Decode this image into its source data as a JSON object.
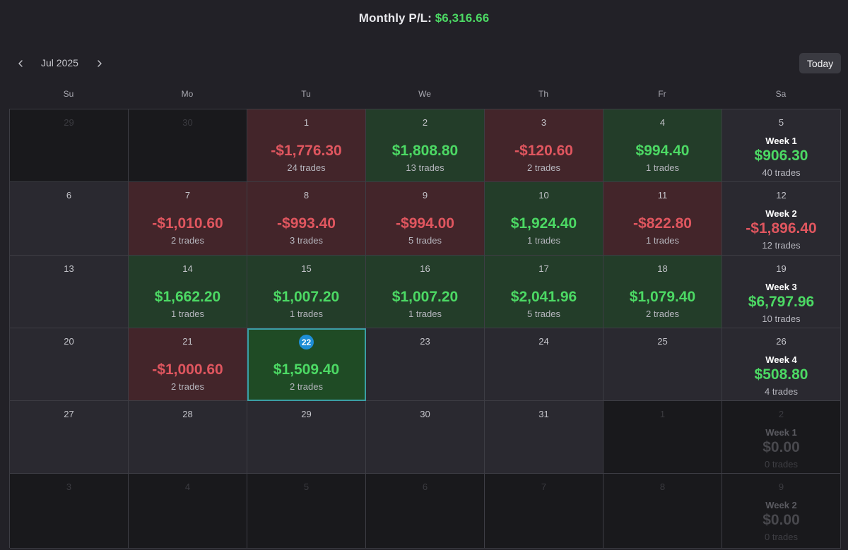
{
  "header": {
    "label": "Monthly P/L:",
    "value": "$6,316.66"
  },
  "nav": {
    "prev_icon": "chevron-left-icon",
    "next_icon": "chevron-right-icon",
    "month": "Jul 2025",
    "today_label": "Today"
  },
  "days_of_week": [
    "Su",
    "Mo",
    "Tu",
    "We",
    "Th",
    "Fr",
    "Sa"
  ],
  "colors": {
    "profit": "#4cd964",
    "loss": "#e0565f",
    "profit_bg": "#233d29",
    "loss_bg": "#43252a",
    "today_ring": "#3a9ea4",
    "today_badge": "#1e8ed6"
  },
  "weeks": [
    {
      "days": [
        {
          "day": "29",
          "muted": true
        },
        {
          "day": "30",
          "muted": true
        },
        {
          "day": "1",
          "pnl": "-$1,776.30",
          "trades": "24 trades",
          "status": "loss"
        },
        {
          "day": "2",
          "pnl": "$1,808.80",
          "trades": "13 trades",
          "status": "profit"
        },
        {
          "day": "3",
          "pnl": "-$120.60",
          "trades": "2 trades",
          "status": "loss"
        },
        {
          "day": "4",
          "pnl": "$994.40",
          "trades": "1 trades",
          "status": "profit"
        }
      ],
      "saturday": {
        "day": "5",
        "week": "Week 1",
        "pnl": "$906.30",
        "trades": "40 trades",
        "status": "profit"
      }
    },
    {
      "days": [
        {
          "day": "6"
        },
        {
          "day": "7",
          "pnl": "-$1,010.60",
          "trades": "2 trades",
          "status": "loss"
        },
        {
          "day": "8",
          "pnl": "-$993.40",
          "trades": "3 trades",
          "status": "loss"
        },
        {
          "day": "9",
          "pnl": "-$994.00",
          "trades": "5 trades",
          "status": "loss"
        },
        {
          "day": "10",
          "pnl": "$1,924.40",
          "trades": "1 trades",
          "status": "profit"
        },
        {
          "day": "11",
          "pnl": "-$822.80",
          "trades": "1 trades",
          "status": "loss"
        }
      ],
      "saturday": {
        "day": "12",
        "week": "Week 2",
        "pnl": "-$1,896.40",
        "trades": "12 trades",
        "status": "loss"
      }
    },
    {
      "days": [
        {
          "day": "13"
        },
        {
          "day": "14",
          "pnl": "$1,662.20",
          "trades": "1 trades",
          "status": "profit"
        },
        {
          "day": "15",
          "pnl": "$1,007.20",
          "trades": "1 trades",
          "status": "profit"
        },
        {
          "day": "16",
          "pnl": "$1,007.20",
          "trades": "1 trades",
          "status": "profit"
        },
        {
          "day": "17",
          "pnl": "$2,041.96",
          "trades": "5 trades",
          "status": "profit"
        },
        {
          "day": "18",
          "pnl": "$1,079.40",
          "trades": "2 trades",
          "status": "profit"
        }
      ],
      "saturday": {
        "day": "19",
        "week": "Week 3",
        "pnl": "$6,797.96",
        "trades": "10 trades",
        "status": "profit"
      }
    },
    {
      "days": [
        {
          "day": "20"
        },
        {
          "day": "21",
          "pnl": "-$1,000.60",
          "trades": "2 trades",
          "status": "loss"
        },
        {
          "day": "22",
          "pnl": "$1,509.40",
          "trades": "2 trades",
          "status": "profit",
          "today": true
        },
        {
          "day": "23"
        },
        {
          "day": "24"
        },
        {
          "day": "25"
        }
      ],
      "saturday": {
        "day": "26",
        "week": "Week 4",
        "pnl": "$508.80",
        "trades": "4 trades",
        "status": "profit"
      }
    },
    {
      "days": [
        {
          "day": "27"
        },
        {
          "day": "28"
        },
        {
          "day": "29"
        },
        {
          "day": "30"
        },
        {
          "day": "31"
        },
        {
          "day": "1",
          "muted": true
        }
      ],
      "saturday": {
        "day": "2",
        "week": "Week 1",
        "pnl": "$0.00",
        "trades": "0 trades",
        "muted": true
      }
    },
    {
      "days": [
        {
          "day": "3",
          "muted": true
        },
        {
          "day": "4",
          "muted": true
        },
        {
          "day": "5",
          "muted": true
        },
        {
          "day": "6",
          "muted": true
        },
        {
          "day": "7",
          "muted": true
        },
        {
          "day": "8",
          "muted": true
        }
      ],
      "saturday": {
        "day": "9",
        "week": "Week 2",
        "pnl": "$0.00",
        "trades": "0 trades",
        "muted": true
      }
    }
  ]
}
